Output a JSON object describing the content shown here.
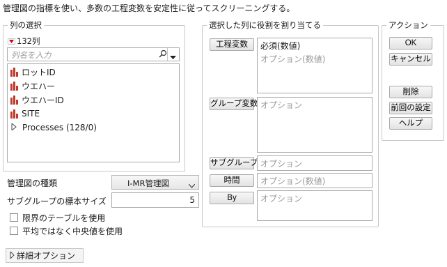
{
  "description": "管理図の指標を使い、多数の工程変数を安定性に従ってスクリーニングする。",
  "column_select": {
    "title": "列の選択",
    "count_label": "132列",
    "search_placeholder": "列名を入力",
    "items": [
      {
        "label": "ロットID"
      },
      {
        "label": "ウエハー"
      },
      {
        "label": "ウエハーID"
      },
      {
        "label": "SITE"
      }
    ],
    "group_item": "Processes (128/0)"
  },
  "roles": {
    "title": "選択した列に役割を割り当てる",
    "process": {
      "button": "工程変数",
      "required": "必須(数値)",
      "optional": "オプション(数値)"
    },
    "group": {
      "button": "グループ変数",
      "placeholder": "オプション"
    },
    "subgroup": {
      "button": "サブグループ",
      "placeholder": "オプション"
    },
    "time": {
      "button": "時間",
      "placeholder": "オプション(数値)"
    },
    "by": {
      "button": "By",
      "placeholder": "オプション"
    }
  },
  "actions": {
    "title": "アクション",
    "ok": "OK",
    "cancel": "キャンセル",
    "remove": "削除",
    "recall": "前回の設定",
    "help": "ヘルプ"
  },
  "options": {
    "chart_type_label": "管理図の種類",
    "chart_type_value": "I-MR管理図",
    "subgroup_size_label": "サブグループの標本サイズ",
    "subgroup_size_value": "5",
    "limits_table_label": "限界のテーブルを使用",
    "median_label": "平均ではなく中央値を使用",
    "advanced_label": "詳細オプション"
  },
  "colors": {
    "bar_icon": "#c0392b",
    "red_triangle": "#d0021b"
  }
}
